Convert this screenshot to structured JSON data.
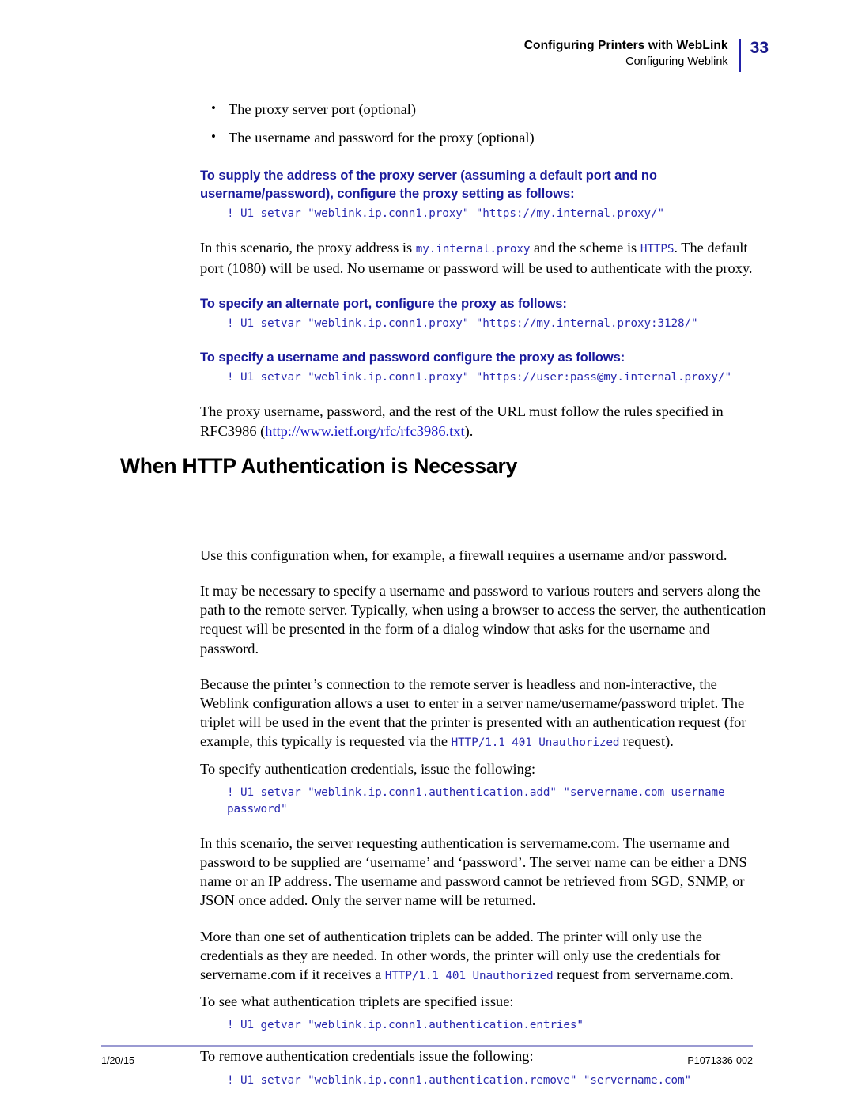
{
  "header": {
    "title": "Configuring Printers with WebLink",
    "subtitle": "Configuring Weblink",
    "page_number": "33",
    "divider_color": "#2222aa",
    "page_number_color": "#1a1a8c"
  },
  "bullets": [
    "The proxy server port (optional)",
    "The username and password for the proxy (optional)"
  ],
  "headings": {
    "proxy_address": "To supply the address of the proxy server (assuming a default port and no username/password), configure the proxy setting as follows:",
    "alternate_port": "To specify an alternate port, configure the proxy as follows:",
    "username_password": "To specify a username and password configure the proxy as follows:",
    "section": "When HTTP Authentication is Necessary",
    "heading_color": "#1a1a9c"
  },
  "code": {
    "proxy_address": "! U1 setvar \"weblink.ip.conn1.proxy\" \"https://my.internal.proxy/\"",
    "alternate_port": "! U1 setvar \"weblink.ip.conn1.proxy\" \"https://my.internal.proxy:3128/\"",
    "username_password": "! U1 setvar \"weblink.ip.conn1.proxy\" \"https://user:pass@my.internal.proxy/\"",
    "auth_add": "! U1 setvar \"weblink.ip.conn1.authentication.add\" \"servername.com username\npassword\"",
    "auth_entries": "! U1 getvar \"weblink.ip.conn1.authentication.entries\"",
    "auth_remove": "! U1 setvar \"weblink.ip.conn1.authentication.remove\" \"servername.com\"",
    "code_color": "#2a2ab0"
  },
  "paragraphs": {
    "scenario_proxy_1": "In this scenario, the proxy address is ",
    "scenario_proxy_code1": "my.internal.proxy",
    "scenario_proxy_2": " and the scheme is ",
    "scenario_proxy_code2": "HTTPS",
    "scenario_proxy_3": ". The default port (1080) will be used. No username or password will be used to authenticate with the proxy.",
    "rfc_1": "The proxy username, password, and the rest of the URL must follow the rules specified in RFC3986 (",
    "rfc_link": "http://www.ietf.org/rfc/rfc3986.txt",
    "rfc_2": ").",
    "firewall": "Use this configuration when, for example, a firewall requires a username and/or password.",
    "necessary": "It may be necessary to specify a username and password to various routers and servers along the path to the remote server. Typically, when using a browser to access the server, the authentication request will be presented in the form of a dialog window that asks for the username and password.",
    "headless_1": "Because the printer’s connection to the remote server is headless and non-interactive, the Weblink configuration allows a user to enter in a server name/username/password triplet. The triplet will be used in the event that the printer is presented with an authentication request (for example, this typically is requested via the ",
    "headless_code": "HTTP/1.1 401 Unauthorized",
    "headless_2": " request).",
    "specify_credentials": "To specify authentication credentials, issue the following:",
    "scenario_auth": "In this scenario, the server requesting authentication is servername.com. The username and password to be supplied are ‘username’ and ‘password’. The server name can be either a DNS name or an IP address. The username and password cannot be retrieved from SGD, SNMP, or JSON once added. Only the server name will be returned.",
    "more_than_one_1": "More than one set of authentication triplets can be added. The printer will only use the credentials as they are needed. In other words, the printer will only use the credentials for servername.com if it receives a ",
    "more_than_one_code": "HTTP/1.1 401 Unauthorized",
    "more_than_one_2": " request from servername.com.",
    "see_triplets": "To see what authentication triplets are specified issue:",
    "remove_credentials": "To remove authentication credentials issue the following:"
  },
  "footer": {
    "date": "1/20/15",
    "doc_id": "P1071336-002",
    "rule_color": "#9a9ad2"
  },
  "bullet_glyph": "•"
}
